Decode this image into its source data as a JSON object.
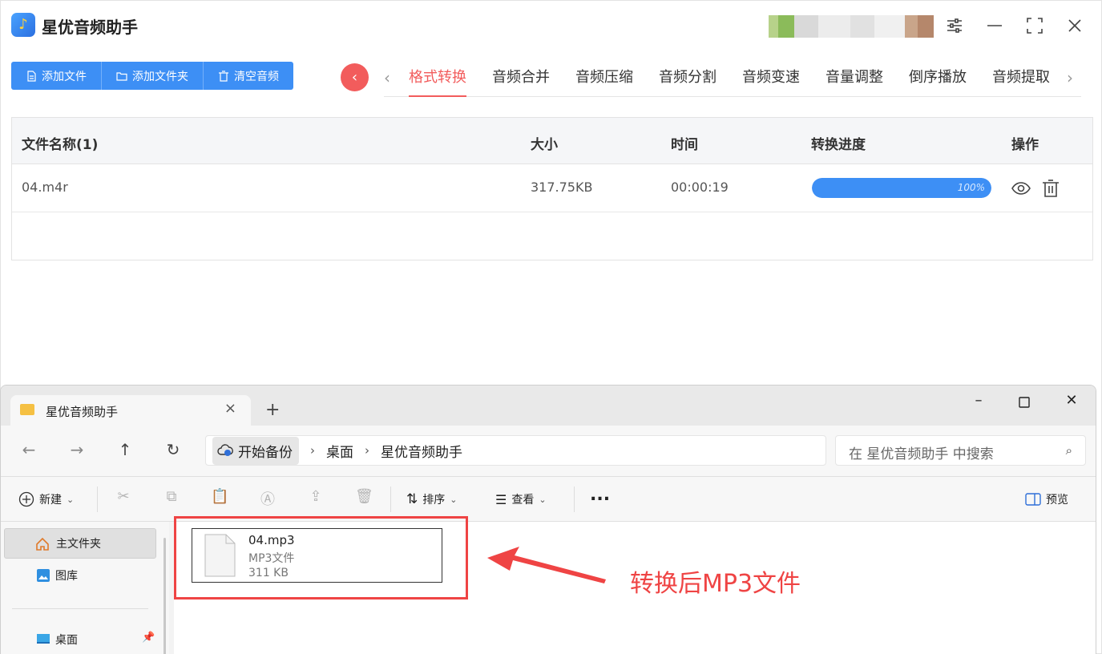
{
  "app": {
    "title": "星优音频助手",
    "toolbar": {
      "add_file": "添加文件",
      "add_folder": "添加文件夹",
      "clear": "清空音频"
    },
    "tabs": [
      "格式转换",
      "音频合并",
      "音频压缩",
      "音频分割",
      "音频变速",
      "音量调整",
      "倒序播放",
      "音频提取"
    ],
    "active_tab": "格式转换",
    "table": {
      "headers": {
        "name": "文件名称(1)",
        "size": "大小",
        "time": "时间",
        "progress": "转换进度",
        "ops": "操作"
      },
      "rows": [
        {
          "name": "04.m4r",
          "size": "317.75KB",
          "time": "00:00:19",
          "progress": 1.0,
          "progress_label": "100%"
        }
      ]
    },
    "colors": {
      "accent": "#3d8ff5",
      "active_tab": "#f25c5c",
      "back_button": "#f25c5c"
    }
  },
  "explorer": {
    "tab_title": "星优音频助手",
    "breadcrumb": [
      "开始备份",
      "桌面",
      "星优音频助手"
    ],
    "search_placeholder": "在 星优音频助手 中搜索",
    "commands": {
      "new": "新建",
      "sort": "排序",
      "view": "查看",
      "more": "...",
      "preview": "预览"
    },
    "sidebar": {
      "home": "主文件夹",
      "gallery": "图库",
      "desktop": "桌面"
    },
    "file": {
      "name": "04.mp3",
      "type": "MP3文件",
      "size": "311 KB"
    }
  },
  "annotation": {
    "text": "转换后MP3文件",
    "color": "#ef4444"
  }
}
